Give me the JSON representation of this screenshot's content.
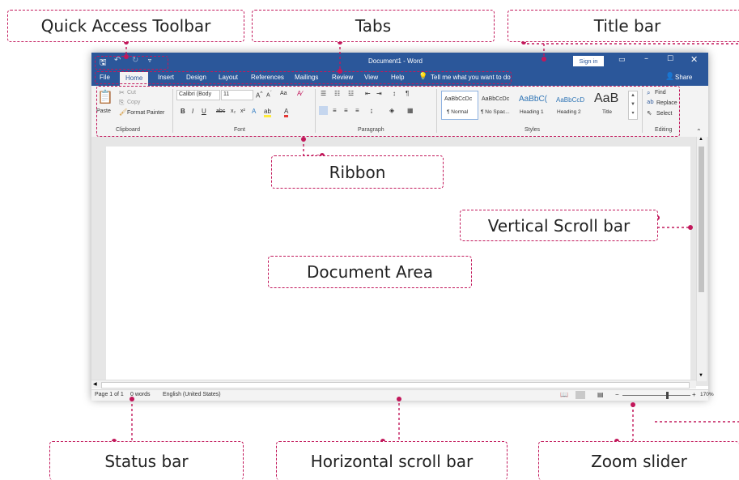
{
  "annotations": {
    "quick_access_toolbar": "Quick Access Toolbar",
    "tabs": "Tabs",
    "title_bar": "Title bar",
    "ribbon": "Ribbon",
    "vertical_scroll_bar": "Vertical Scroll bar",
    "document_area": "Document Area",
    "status_bar": "Status bar",
    "horizontal_scroll_bar": "Horizontal scroll bar",
    "zoom_slider": "Zoom slider"
  },
  "titlebar": {
    "title": "Document1  -  Word",
    "sign_in": "Sign in"
  },
  "tabs": [
    "File",
    "Home",
    "Insert",
    "Design",
    "Layout",
    "References",
    "Mailings",
    "Review",
    "View",
    "Help"
  ],
  "tell_me": "Tell me what you want to do",
  "share": "Share",
  "ribbon": {
    "clipboard": {
      "paste": "Paste",
      "cut": "Cut",
      "copy": "Copy",
      "format_painter": "Format Painter",
      "label": "Clipboard"
    },
    "font": {
      "name": "Calibri (Body",
      "size": "11",
      "label": "Font",
      "case": "Aa"
    },
    "paragraph": {
      "label": "Paragraph"
    },
    "styles": {
      "label": "Styles",
      "items": [
        {
          "preview": "AaBbCcDc",
          "name": "¶ Normal"
        },
        {
          "preview": "AaBbCcDc",
          "name": "¶ No Spac..."
        },
        {
          "preview": "AaBbC(",
          "name": "Heading 1"
        },
        {
          "preview": "AaBbCcD",
          "name": "Heading 2"
        },
        {
          "preview": "AaB",
          "name": "Title"
        }
      ]
    },
    "editing": {
      "find": "Find",
      "replace": "Replace",
      "select": "Select",
      "label": "Editing"
    }
  },
  "statusbar": {
    "page": "Page 1 of 1",
    "words": "0 words",
    "language": "English (United States)",
    "zoom": "170%",
    "zoom_level": 0.65
  },
  "colors": {
    "word_blue": "#2b579a",
    "annotation": "#c2185b"
  }
}
